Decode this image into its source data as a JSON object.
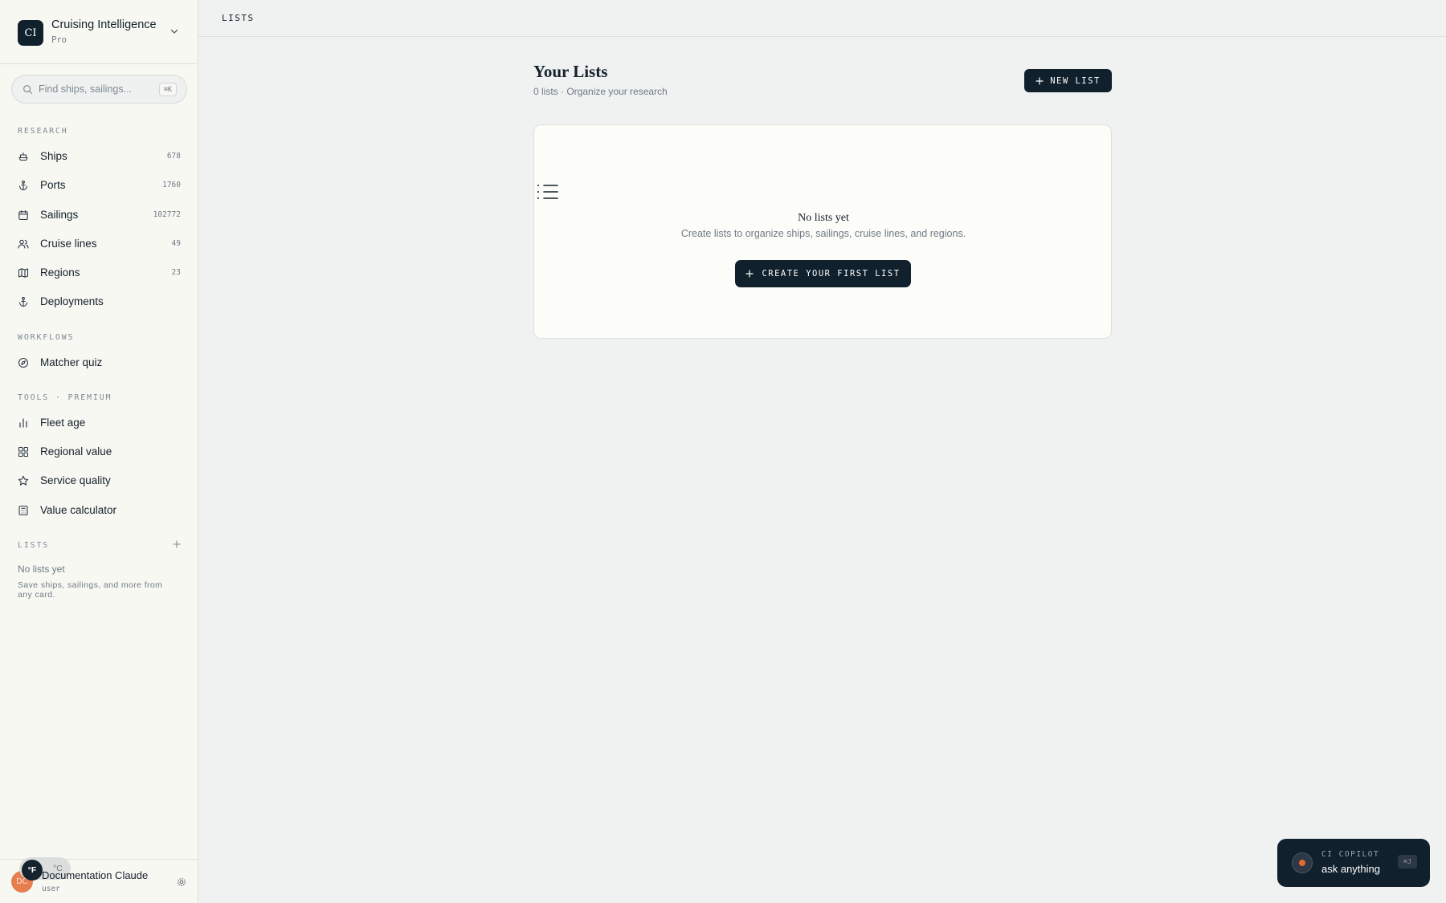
{
  "brand": {
    "logo": "CI",
    "name": "Cruising Intelligence",
    "plan": "Pro"
  },
  "search": {
    "placeholder": "Find ships, sailings...",
    "shortcut": "⌘K"
  },
  "sections": {
    "research": "RESEARCH",
    "workflows": "WORKFLOWS",
    "tools": "TOOLS · PREMIUM",
    "lists": "LISTS"
  },
  "nav": {
    "ships": {
      "label": "Ships",
      "count": "678",
      "icon": "ship-icon"
    },
    "ports": {
      "label": "Ports",
      "count": "1760",
      "icon": "anchor-icon"
    },
    "sailings": {
      "label": "Sailings",
      "count": "102772",
      "icon": "calendar-icon"
    },
    "cruise_lines": {
      "label": "Cruise lines",
      "count": "49",
      "icon": "users-icon"
    },
    "regions": {
      "label": "Regions",
      "count": "23",
      "icon": "map-icon"
    },
    "deployments": {
      "label": "Deployments",
      "icon": "anchor-icon"
    },
    "matcher_quiz": {
      "label": "Matcher quiz",
      "icon": "compass-icon"
    },
    "fleet_age": {
      "label": "Fleet age",
      "icon": "bar-chart-icon"
    },
    "regional_value": {
      "label": "Regional value",
      "icon": "grid-icon"
    },
    "service_quality": {
      "label": "Service quality",
      "icon": "star-icon"
    },
    "value_calculator": {
      "label": "Value calculator",
      "icon": "calculator-icon"
    }
  },
  "sidebar_lists": {
    "empty_title": "No lists yet",
    "empty_hint": "Save ships, sailings, and more from any card."
  },
  "user": {
    "initials": "DC",
    "name": "Documentation Claude",
    "role": "user",
    "unit_f": "°F",
    "unit_c": "°C"
  },
  "header": {
    "breadcrumb": "LISTS"
  },
  "main": {
    "title": "Your Lists",
    "subtitle": "0 lists · Organize your research",
    "new_list_label": "NEW LIST",
    "empty_title": "No lists yet",
    "empty_desc": "Create lists to organize ships, sailings, cruise lines, and regions.",
    "create_label": "CREATE YOUR FIRST LIST"
  },
  "copilot": {
    "label": "CI COPILOT",
    "prompt": "ask anything",
    "shortcut": "⌘J"
  },
  "colors": {
    "navy": "#10202c",
    "accent": "#e6692e",
    "avatar": "#e77e4f",
    "background": "#eff2f1",
    "sidebar": "#f8f8f3"
  }
}
